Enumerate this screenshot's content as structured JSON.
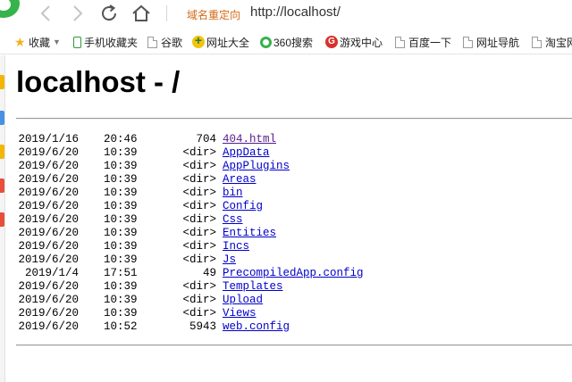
{
  "browser": {
    "redirect_label": "域名重定向",
    "url": "http://localhost/"
  },
  "bookmarks": {
    "favorites": "收藏",
    "items": [
      {
        "label": "手机收藏夹",
        "icon": "phone-icon"
      },
      {
        "label": "谷歌",
        "icon": "page-icon"
      },
      {
        "label": "网址大全",
        "icon": "web-directory-icon"
      },
      {
        "label": "360搜索",
        "icon": "360-search-icon"
      },
      {
        "label": "游戏中心",
        "icon": "game-center-icon"
      },
      {
        "label": "百度一下",
        "icon": "page-icon"
      },
      {
        "label": "网址导航",
        "icon": "page-icon"
      },
      {
        "label": "淘宝网",
        "icon": "page-icon"
      }
    ]
  },
  "page": {
    "title": "localhost - /",
    "entries": [
      {
        "date": "2019/1/16",
        "time": "20:46",
        "size": "704",
        "name": "404.html",
        "visited": true
      },
      {
        "date": "2019/6/20",
        "time": "10:39",
        "size": "<dir>",
        "name": "AppData"
      },
      {
        "date": "2019/6/20",
        "time": "10:39",
        "size": "<dir>",
        "name": "AppPlugins"
      },
      {
        "date": "2019/6/20",
        "time": "10:39",
        "size": "<dir>",
        "name": "Areas"
      },
      {
        "date": "2019/6/20",
        "time": "10:39",
        "size": "<dir>",
        "name": "bin"
      },
      {
        "date": "2019/6/20",
        "time": "10:39",
        "size": "<dir>",
        "name": "Config"
      },
      {
        "date": "2019/6/20",
        "time": "10:39",
        "size": "<dir>",
        "name": "Css"
      },
      {
        "date": "2019/6/20",
        "time": "10:39",
        "size": "<dir>",
        "name": "Entities"
      },
      {
        "date": "2019/6/20",
        "time": "10:39",
        "size": "<dir>",
        "name": "Incs"
      },
      {
        "date": "2019/6/20",
        "time": "10:39",
        "size": "<dir>",
        "name": "Js"
      },
      {
        "date": "2019/1/4",
        "time": "17:51",
        "size": "49",
        "name": "PrecompiledApp.config"
      },
      {
        "date": "2019/6/20",
        "time": "10:39",
        "size": "<dir>",
        "name": "Templates"
      },
      {
        "date": "2019/6/20",
        "time": "10:39",
        "size": "<dir>",
        "name": "Upload"
      },
      {
        "date": "2019/6/20",
        "time": "10:39",
        "size": "<dir>",
        "name": "Views"
      },
      {
        "date": "2019/6/20",
        "time": "10:52",
        "size": "5943",
        "name": "web.config"
      }
    ]
  },
  "colors": {
    "link": "#0000cc",
    "visited_link": "#551a8b",
    "redirect_label": "#d46a17"
  }
}
